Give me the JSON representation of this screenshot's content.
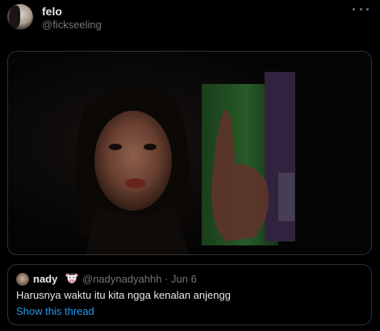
{
  "author": {
    "name": "felo",
    "handle": "@fickseeling"
  },
  "more_icon": "more-horizontal-icon",
  "media": {
    "type": "video-still",
    "description_colors": {
      "background": "#050505",
      "green_panel": "#2f6b2f",
      "purple_panel": "#3a2a4a"
    }
  },
  "quote": {
    "name": "nady",
    "emoji_icon": "cow-face-icon",
    "handle_and_date": "@nadynadyahhh · Jun 6",
    "text": "Harusnya waktu itu kita ngga kenalan anjengg",
    "link_label": "Show this thread",
    "link_color": "#1d9bf0"
  }
}
